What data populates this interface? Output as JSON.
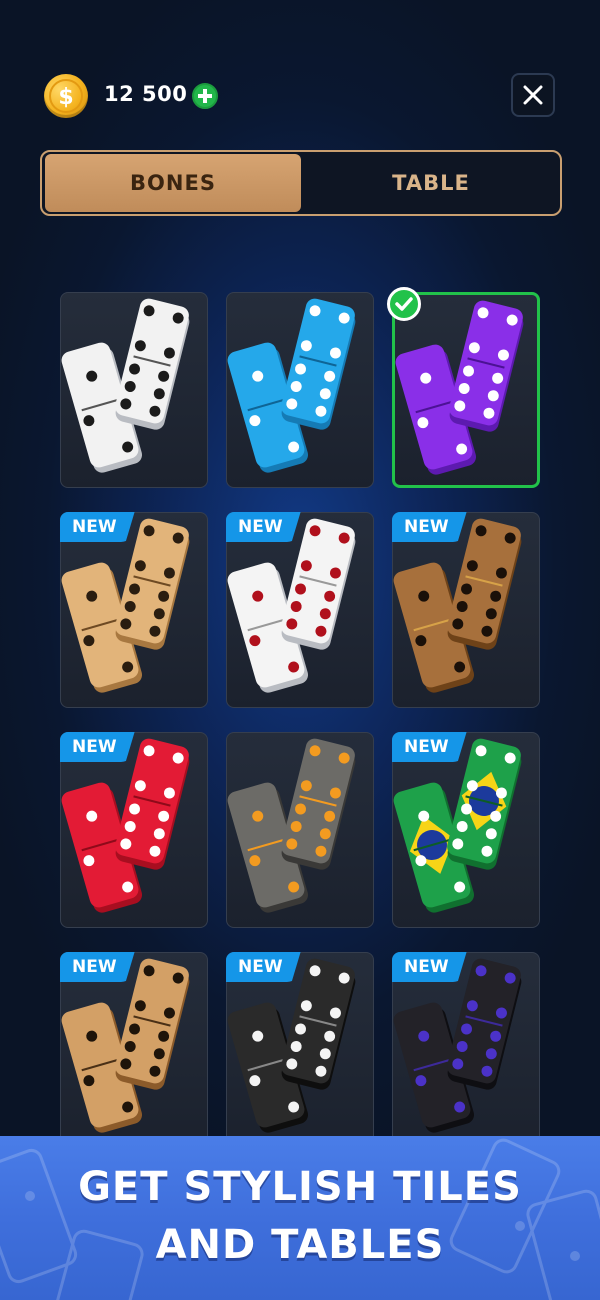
{
  "header": {
    "coin_icon": "coin-icon",
    "coins": "12 500",
    "add_icon": "plus-icon",
    "close_icon": "close-icon"
  },
  "tabs": [
    {
      "label": "BONES",
      "active": true
    },
    {
      "label": "TABLE",
      "active": false
    }
  ],
  "badge_label": "NEW",
  "tiles": [
    {
      "style": "white",
      "is_new": false,
      "selected": false
    },
    {
      "style": "blue",
      "is_new": false,
      "selected": false
    },
    {
      "style": "purple",
      "is_new": false,
      "selected": true
    },
    {
      "style": "light-wood",
      "is_new": true,
      "selected": false
    },
    {
      "style": "white-red-pips",
      "is_new": true,
      "selected": false
    },
    {
      "style": "dark-wood",
      "is_new": true,
      "selected": false
    },
    {
      "style": "red",
      "is_new": true,
      "selected": false
    },
    {
      "style": "grey-wood",
      "is_new": false,
      "selected": false
    },
    {
      "style": "brazil-flag",
      "is_new": true,
      "selected": false
    },
    {
      "style": "oak-wood",
      "is_new": true,
      "selected": false
    },
    {
      "style": "black-white-pips",
      "is_new": true,
      "selected": false
    },
    {
      "style": "black-purple-pips",
      "is_new": true,
      "selected": false
    }
  ],
  "footer": {
    "line1": "GET STYLISH TILES",
    "line2": "AND TABLES"
  },
  "colors": {
    "accent_gold": "#c99f70",
    "selected_green": "#22c24a",
    "badge_blue": "#1596e8",
    "footer_blue": "#4a7de8"
  }
}
